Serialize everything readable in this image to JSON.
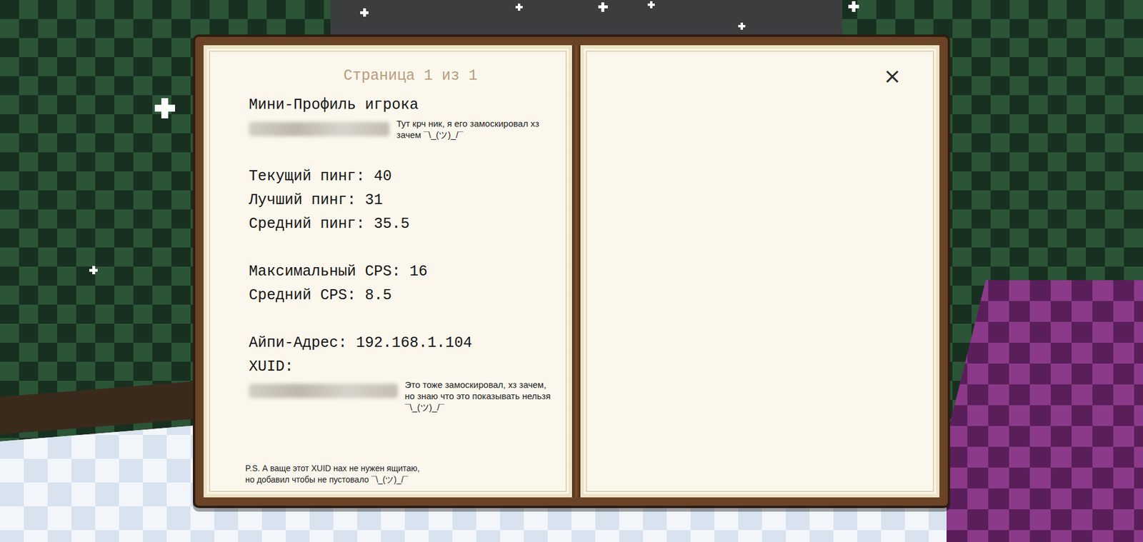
{
  "book": {
    "page_indicator": "Страница 1 из 1",
    "close_button": "×"
  },
  "profile": {
    "title": "Мини-Профиль игрока",
    "nickname": {
      "redacted": true,
      "note": "Тут крч ник, я  его замоскировал хз зачем ¯\\_(ツ)_/¯"
    },
    "stat_groups": [
      [
        {
          "label": "Текущий пинг:",
          "value": "40"
        },
        {
          "label": "Лучший пинг:",
          "value": "31"
        },
        {
          "label": "Средний пинг:",
          "value": "35.5"
        }
      ],
      [
        {
          "label": "Максимальный CPS:",
          "value": "16"
        },
        {
          "label": "Средний CPS:",
          "value": "8.5"
        }
      ],
      [
        {
          "label": "Айпи-Адрес:",
          "value": "192.168.1.104"
        }
      ]
    ],
    "xuid": {
      "label": "XUID:",
      "redacted": true,
      "note": "Это тоже замоскировал, хз зачем, но знаю что это показывать нельзя ¯\\_(ツ)_/¯"
    }
  },
  "footnote": "P.S. А ваще этот XUID нах не нужен ящитаю, но добавил чтобы не пустовало ¯\\_(ツ)_/¯"
}
